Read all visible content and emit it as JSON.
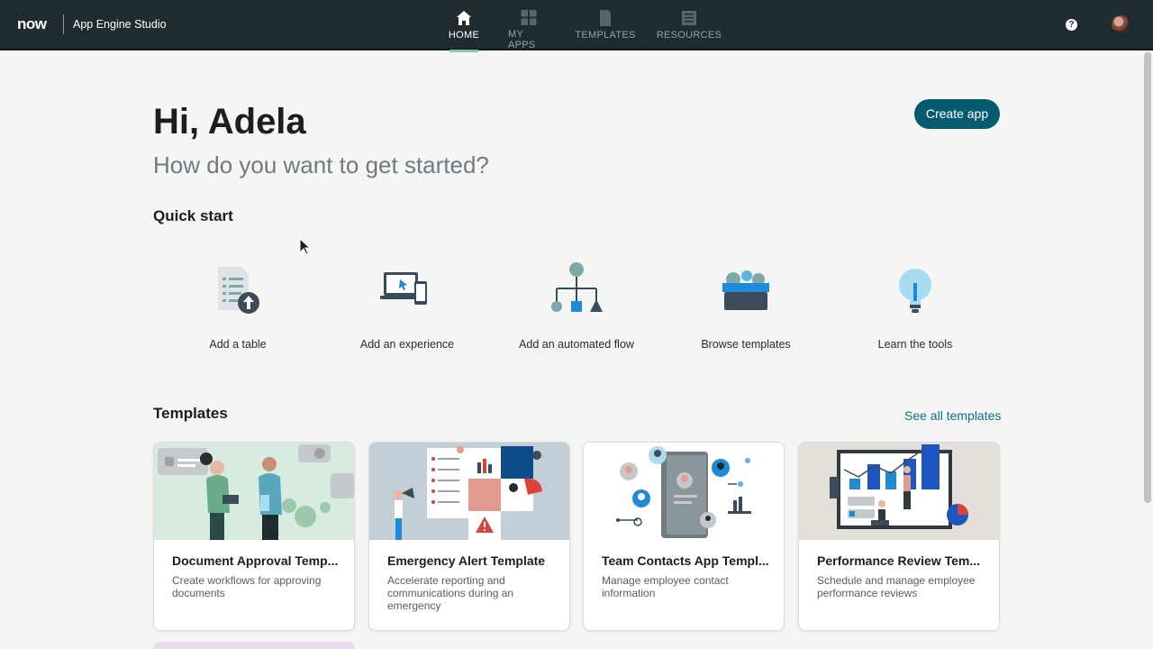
{
  "topbar": {
    "logo": "now",
    "app_name": "App Engine Studio",
    "nav": [
      {
        "label": "HOME",
        "icon": "home-icon",
        "active": true
      },
      {
        "label": "MY APPS",
        "icon": "grid-icon",
        "active": false
      },
      {
        "label": "TEMPLATES",
        "icon": "document-icon",
        "active": false
      },
      {
        "label": "RESOURCES",
        "icon": "book-icon",
        "active": false
      }
    ],
    "help_glyph": "?"
  },
  "header": {
    "greeting": "Hi, Adela",
    "subtitle": "How do you want to get started?",
    "create_app": "Create app"
  },
  "quick_start": {
    "title": "Quick start",
    "items": [
      {
        "label": "Add a table",
        "icon": "table-upload-icon"
      },
      {
        "label": "Add an experience",
        "icon": "devices-icon"
      },
      {
        "label": "Add an automated flow",
        "icon": "flow-icon"
      },
      {
        "label": "Browse templates",
        "icon": "template-box-icon"
      },
      {
        "label": "Learn the tools",
        "icon": "lightbulb-icon"
      }
    ]
  },
  "templates": {
    "title": "Templates",
    "see_all": "See all templates",
    "cards": [
      {
        "title": "Document Approval Temp...",
        "desc": "Create workflows for approving documents"
      },
      {
        "title": "Emergency Alert Template",
        "desc": "Accelerate reporting and communications during an emergency"
      },
      {
        "title": "Team Contacts App Templ...",
        "desc": "Manage employee contact information"
      },
      {
        "title": "Performance Review Tem...",
        "desc": "Schedule and manage employee performance reviews"
      }
    ]
  },
  "colors": {
    "topbar": "#1f2b2f",
    "accent": "#045b6f",
    "link": "#0f6e8a",
    "active_indicator": "#7fc9b3"
  }
}
